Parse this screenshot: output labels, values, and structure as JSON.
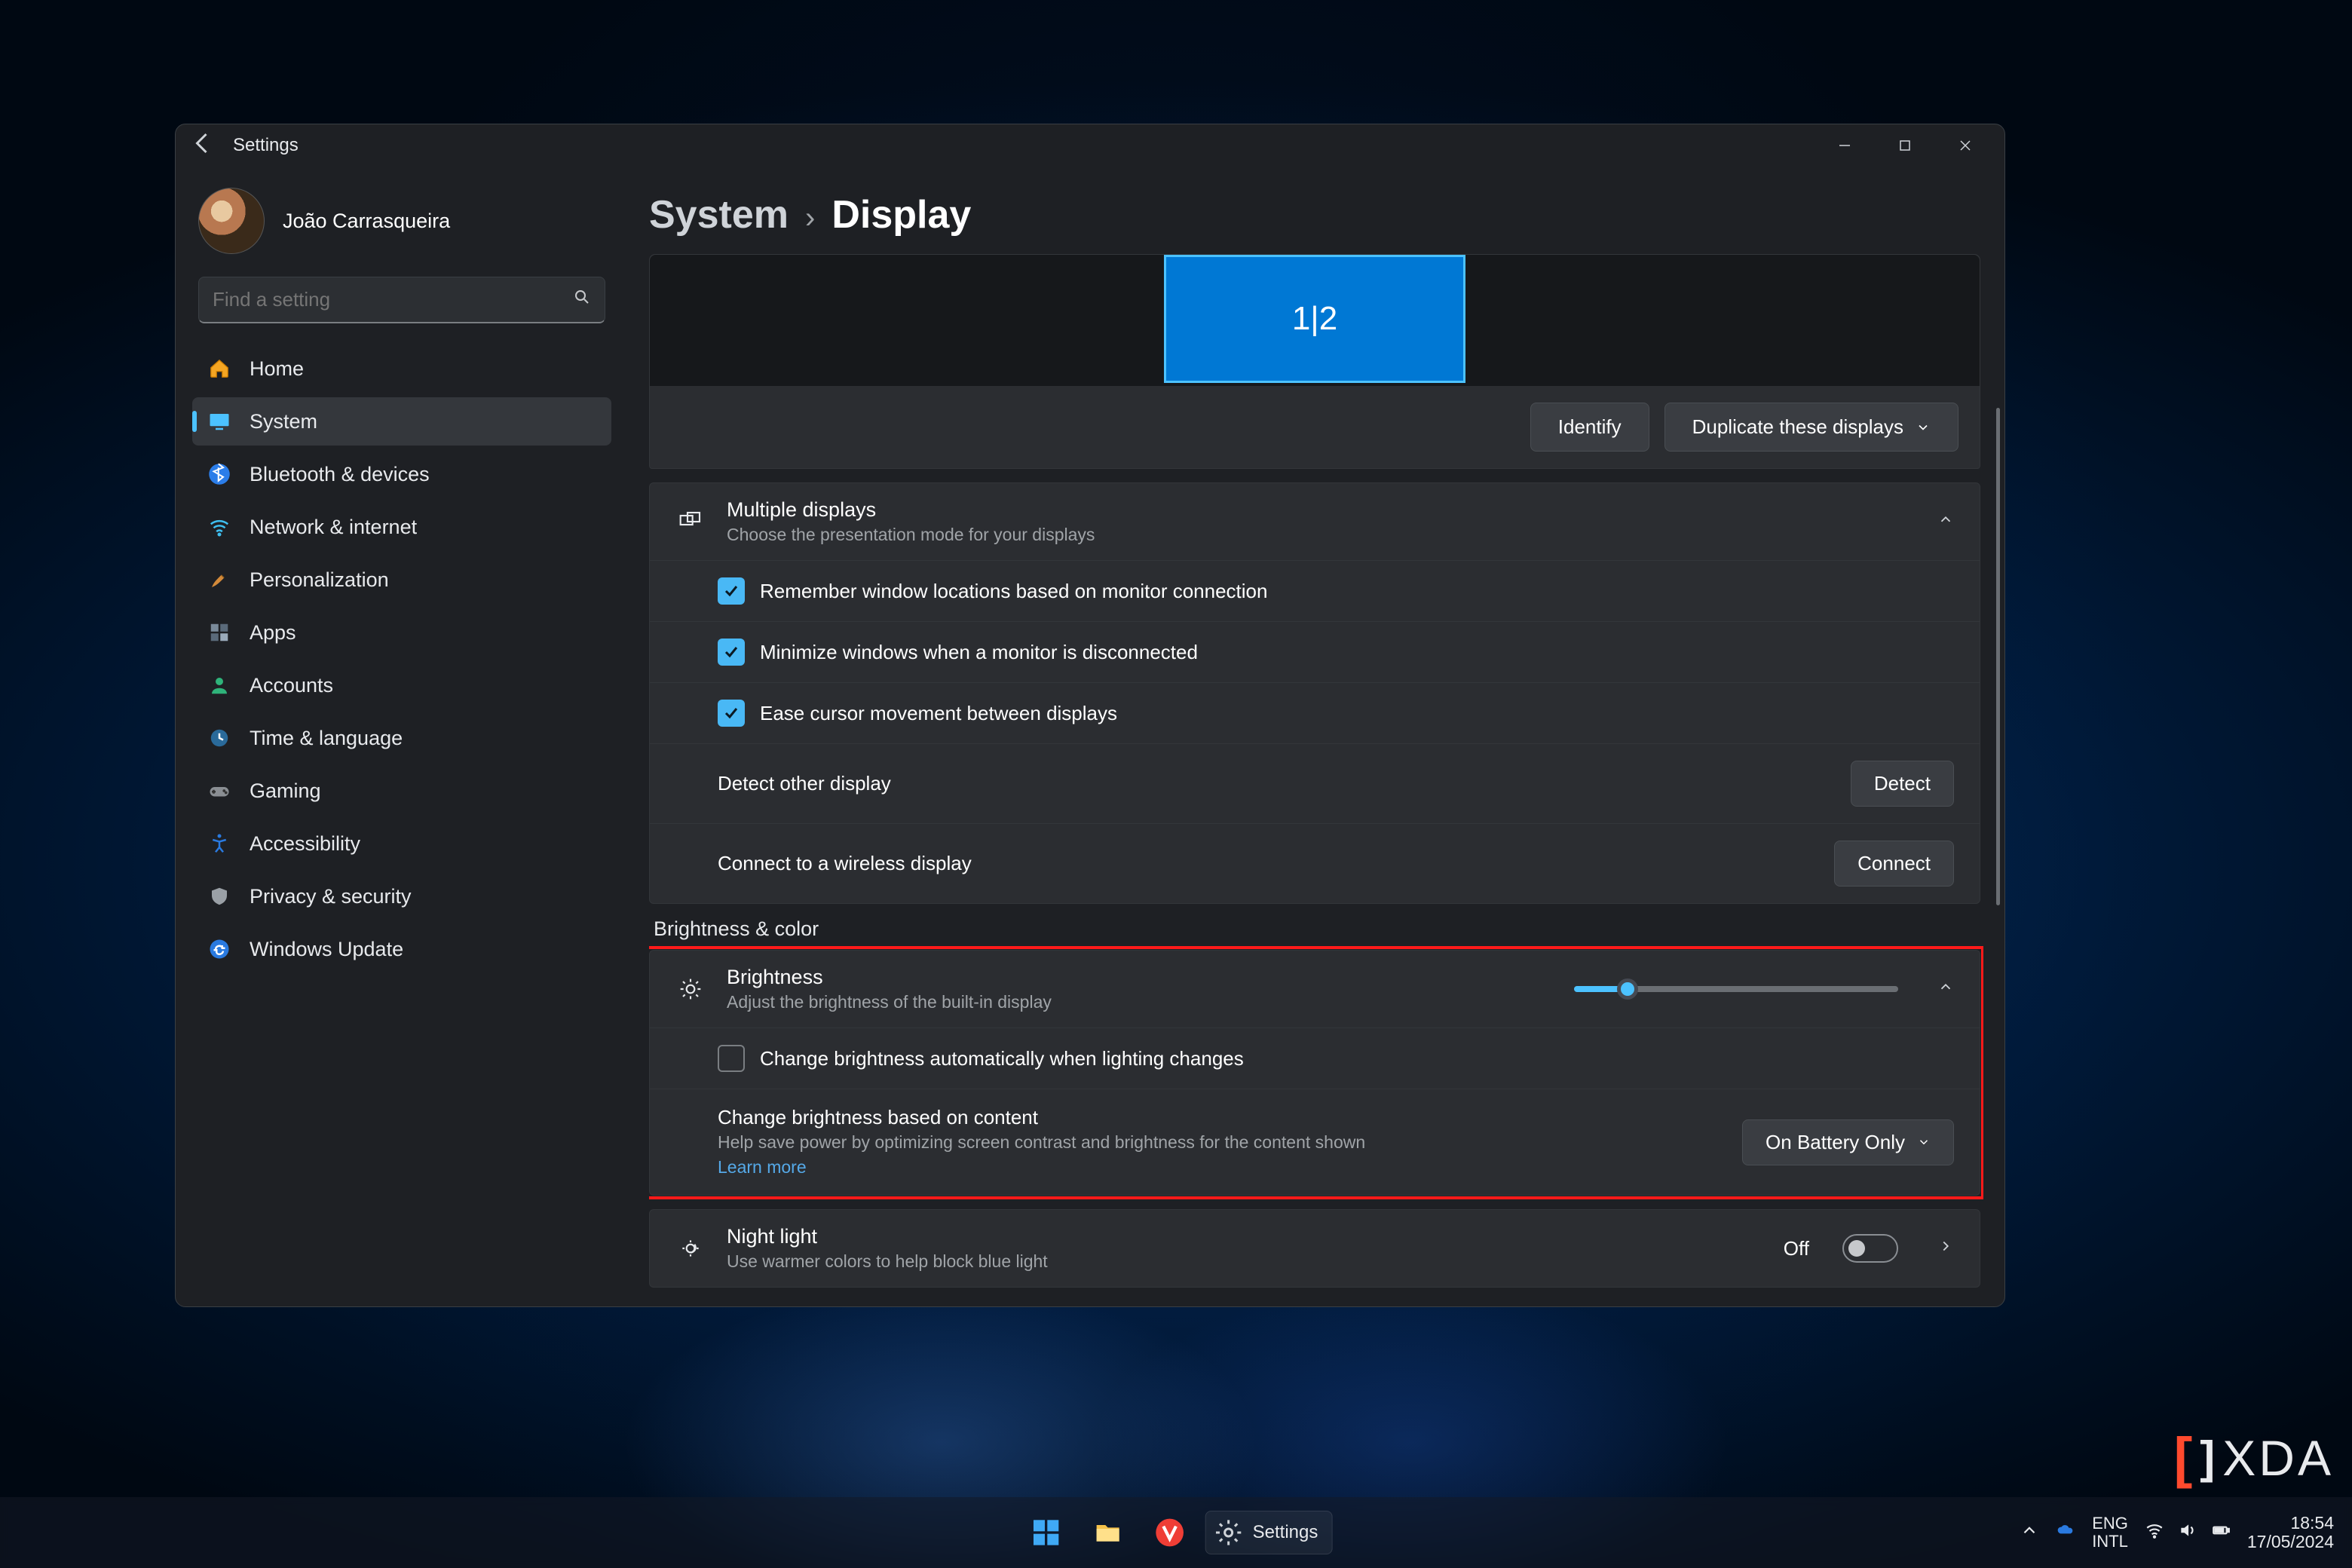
{
  "window": {
    "title": "Settings",
    "user": "João Carrasqueira",
    "search_placeholder": "Find a setting"
  },
  "nav": [
    {
      "icon": "home",
      "label": "Home"
    },
    {
      "icon": "system",
      "label": "System",
      "active": true
    },
    {
      "icon": "bluetooth",
      "label": "Bluetooth & devices"
    },
    {
      "icon": "wifi",
      "label": "Network & internet"
    },
    {
      "icon": "brush",
      "label": "Personalization"
    },
    {
      "icon": "apps",
      "label": "Apps"
    },
    {
      "icon": "accounts",
      "label": "Accounts"
    },
    {
      "icon": "time",
      "label": "Time & language"
    },
    {
      "icon": "gaming",
      "label": "Gaming"
    },
    {
      "icon": "accessibility",
      "label": "Accessibility"
    },
    {
      "icon": "privacy",
      "label": "Privacy & security"
    },
    {
      "icon": "update",
      "label": "Windows Update"
    }
  ],
  "breadcrumb": {
    "parent": "System",
    "current": "Display"
  },
  "displayArrange": {
    "tile_label": "1|2",
    "identify_btn": "Identify",
    "mode_dropdown": "Duplicate these displays"
  },
  "multipleDisplays": {
    "title": "Multiple displays",
    "subtitle": "Choose the presentation mode for your displays",
    "opt_remember": "Remember window locations based on monitor connection",
    "opt_minimize": "Minimize windows when a monitor is disconnected",
    "opt_ease": "Ease cursor movement between displays",
    "detect_other": "Detect other display",
    "detect_btn": "Detect",
    "connect_wireless": "Connect to a wireless display",
    "connect_btn": "Connect"
  },
  "brightnessColor": {
    "section_title": "Brightness & color",
    "brightness_title": "Brightness",
    "brightness_sub": "Adjust the brightness of the built-in display",
    "brightness_pct": 16,
    "auto_brightness": "Change brightness automatically when lighting changes",
    "content_brightness_title": "Change brightness based on content",
    "content_brightness_sub": "Help save power by optimizing screen contrast and brightness for the content shown",
    "learn_more": "Learn more",
    "content_mode": "On Battery Only",
    "night_light_title": "Night light",
    "night_light_sub": "Use warmer colors to help block blue light",
    "night_light_state": "Off"
  },
  "taskbar": {
    "settings_label": "Settings",
    "lang1": "ENG",
    "lang2": "INTL",
    "time": "18:54",
    "date": "17/05/2024"
  },
  "watermark": "XDA"
}
